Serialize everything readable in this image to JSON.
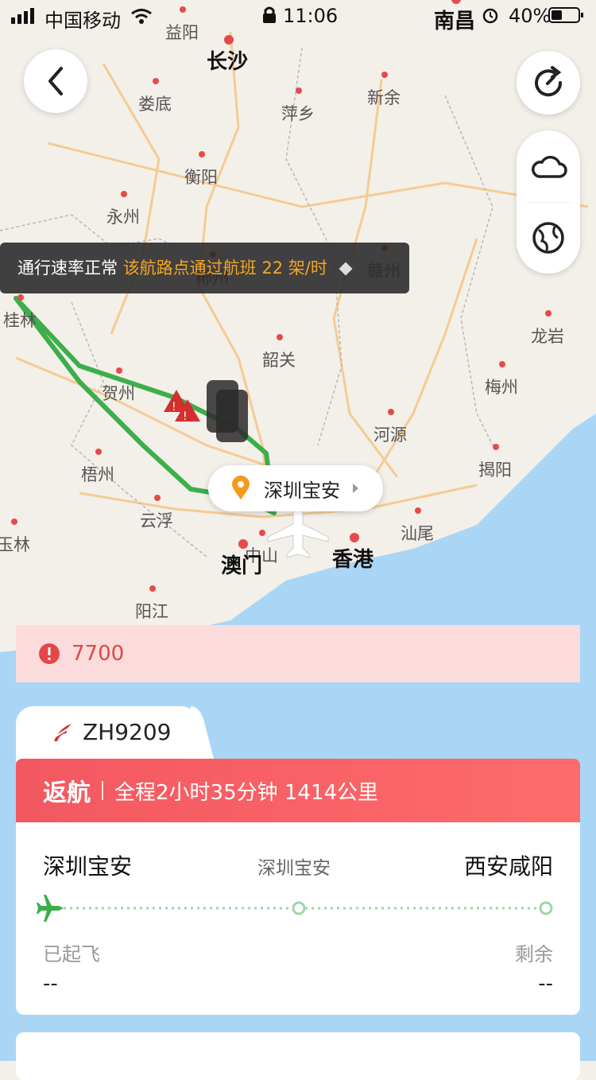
{
  "status_bar": {
    "carrier": "中国移动",
    "time": "11:06",
    "battery": "40%"
  },
  "map": {
    "cities": [
      {
        "name": "益阳",
        "big": false
      },
      {
        "name": "长沙",
        "big": true
      },
      {
        "name": "娄底",
        "big": false
      },
      {
        "name": "新余",
        "big": false
      },
      {
        "name": "萍乡",
        "big": false
      },
      {
        "name": "衡阳",
        "big": false
      },
      {
        "name": "永州",
        "big": false
      },
      {
        "name": "郴州",
        "big": false
      },
      {
        "name": "赣州",
        "big": false
      },
      {
        "name": "桂林",
        "big": false
      },
      {
        "name": "龙岩",
        "big": false
      },
      {
        "name": "韶关",
        "big": false
      },
      {
        "name": "贺州",
        "big": false
      },
      {
        "name": "梅州",
        "big": false
      },
      {
        "name": "河源",
        "big": false
      },
      {
        "name": "梧州",
        "big": false
      },
      {
        "name": "揭阳",
        "big": false
      },
      {
        "name": "云浮",
        "big": false
      },
      {
        "name": "汕尾",
        "big": false
      },
      {
        "name": "玉林",
        "big": false
      },
      {
        "name": "中山",
        "big": false
      },
      {
        "name": "澳门",
        "big": true
      },
      {
        "name": "香港",
        "big": true
      },
      {
        "name": "阳江",
        "big": false
      },
      {
        "name": "南昌",
        "big": true
      }
    ]
  },
  "banner": {
    "normal_text": "通行速率正常",
    "highlight_text": "该航路点通过航班 22 架/时"
  },
  "location_pill": {
    "label": "深圳宝安"
  },
  "alert": {
    "code": "7700"
  },
  "flight": {
    "number": "ZH9209",
    "status": "返航",
    "summary": "全程2小时35分钟 1414公里",
    "origin": "深圳宝安",
    "current": "深圳宝安",
    "destination": "西安咸阳",
    "left_label": "已起飞",
    "left_value": "--",
    "right_label": "剩余",
    "right_value": "--"
  },
  "colors": {
    "route": "#3cae4a",
    "alert_red": "#e24848",
    "status_head": "#f25860",
    "banner_highlight": "#f5a623",
    "pin": "#f59a1b"
  }
}
